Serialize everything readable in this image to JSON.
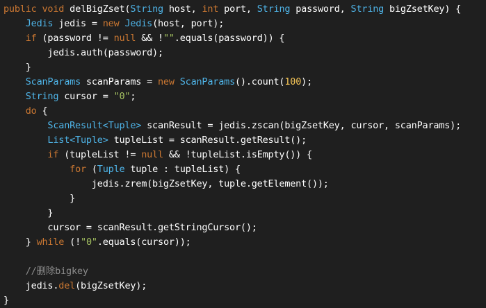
{
  "editor": {
    "theme_colors": {
      "background": "#1f1f1f",
      "plain": "#ffffff",
      "keyword": "#cc7832",
      "type": "#4fb5e9",
      "string": "#a5c261",
      "number": "#f9c858",
      "comment": "#8c8c8c"
    },
    "lines": [
      {
        "indent": 0,
        "tokens": [
          {
            "t": "kw",
            "v": "public void "
          },
          {
            "t": "plain",
            "v": "delBigZset("
          },
          {
            "t": "type",
            "v": "String"
          },
          {
            "t": "plain",
            "v": " host, "
          },
          {
            "t": "kw",
            "v": "int"
          },
          {
            "t": "plain",
            "v": " port, "
          },
          {
            "t": "type",
            "v": "String"
          },
          {
            "t": "plain",
            "v": " password, "
          },
          {
            "t": "type",
            "v": "String"
          },
          {
            "t": "plain",
            "v": " bigZsetKey) {"
          }
        ]
      },
      {
        "indent": 1,
        "tokens": [
          {
            "t": "type",
            "v": "Jedis"
          },
          {
            "t": "plain",
            "v": " jedis = "
          },
          {
            "t": "kw",
            "v": "new "
          },
          {
            "t": "type",
            "v": "Jedis"
          },
          {
            "t": "plain",
            "v": "(host, port);"
          }
        ]
      },
      {
        "indent": 1,
        "tokens": [
          {
            "t": "kw",
            "v": "if"
          },
          {
            "t": "plain",
            "v": " (password != "
          },
          {
            "t": "kw",
            "v": "null"
          },
          {
            "t": "plain",
            "v": " && !"
          },
          {
            "t": "str",
            "v": "\"\""
          },
          {
            "t": "plain",
            "v": ".equals(password)) {"
          }
        ]
      },
      {
        "indent": 2,
        "tokens": [
          {
            "t": "plain",
            "v": "jedis.auth(password);"
          }
        ]
      },
      {
        "indent": 1,
        "tokens": [
          {
            "t": "plain",
            "v": "}"
          }
        ]
      },
      {
        "indent": 1,
        "tokens": [
          {
            "t": "type",
            "v": "ScanParams"
          },
          {
            "t": "plain",
            "v": " scanParams = "
          },
          {
            "t": "kw",
            "v": "new "
          },
          {
            "t": "type",
            "v": "ScanParams"
          },
          {
            "t": "plain",
            "v": "().count("
          },
          {
            "t": "num",
            "v": "100"
          },
          {
            "t": "plain",
            "v": ");"
          }
        ]
      },
      {
        "indent": 1,
        "tokens": [
          {
            "t": "type",
            "v": "String"
          },
          {
            "t": "plain",
            "v": " cursor = "
          },
          {
            "t": "str",
            "v": "\"0\""
          },
          {
            "t": "plain",
            "v": ";"
          }
        ]
      },
      {
        "indent": 1,
        "tokens": [
          {
            "t": "kw",
            "v": "do"
          },
          {
            "t": "plain",
            "v": " {"
          }
        ]
      },
      {
        "indent": 2,
        "tokens": [
          {
            "t": "type",
            "v": "ScanResult<Tuple>"
          },
          {
            "t": "plain",
            "v": " scanResult = jedis.zscan(bigZsetKey, cursor, scanParams);"
          }
        ]
      },
      {
        "indent": 2,
        "tokens": [
          {
            "t": "type",
            "v": "List<Tuple>"
          },
          {
            "t": "plain",
            "v": " tupleList = scanResult.getResult();"
          }
        ]
      },
      {
        "indent": 2,
        "tokens": [
          {
            "t": "kw",
            "v": "if"
          },
          {
            "t": "plain",
            "v": " (tupleList != "
          },
          {
            "t": "kw",
            "v": "null"
          },
          {
            "t": "plain",
            "v": " && !tupleList.isEmpty()) {"
          }
        ]
      },
      {
        "indent": 3,
        "tokens": [
          {
            "t": "kw",
            "v": "for"
          },
          {
            "t": "plain",
            "v": " ("
          },
          {
            "t": "type",
            "v": "Tuple"
          },
          {
            "t": "plain",
            "v": " tuple : tupleList) {"
          }
        ]
      },
      {
        "indent": 4,
        "tokens": [
          {
            "t": "plain",
            "v": "jedis.zrem(bigZsetKey, tuple.getElement());"
          }
        ]
      },
      {
        "indent": 3,
        "tokens": [
          {
            "t": "plain",
            "v": "}"
          }
        ]
      },
      {
        "indent": 2,
        "tokens": [
          {
            "t": "plain",
            "v": "}"
          }
        ]
      },
      {
        "indent": 2,
        "tokens": [
          {
            "t": "plain",
            "v": "cursor = scanResult.getStringCursor();"
          }
        ]
      },
      {
        "indent": 1,
        "tokens": [
          {
            "t": "plain",
            "v": "} "
          },
          {
            "t": "kw",
            "v": "while"
          },
          {
            "t": "plain",
            "v": " (!"
          },
          {
            "t": "str",
            "v": "\"0\""
          },
          {
            "t": "plain",
            "v": ".equals(cursor));"
          }
        ]
      },
      {
        "indent": 0,
        "tokens": []
      },
      {
        "indent": 1,
        "tokens": [
          {
            "t": "comment",
            "v": "//删除bigkey"
          }
        ]
      },
      {
        "indent": 1,
        "tokens": [
          {
            "t": "plain",
            "v": "jedis."
          },
          {
            "t": "kw",
            "v": "del"
          },
          {
            "t": "plain",
            "v": "(bigZsetKey);"
          }
        ]
      },
      {
        "indent": 0,
        "tokens": [
          {
            "t": "plain",
            "v": "}"
          }
        ]
      }
    ]
  }
}
